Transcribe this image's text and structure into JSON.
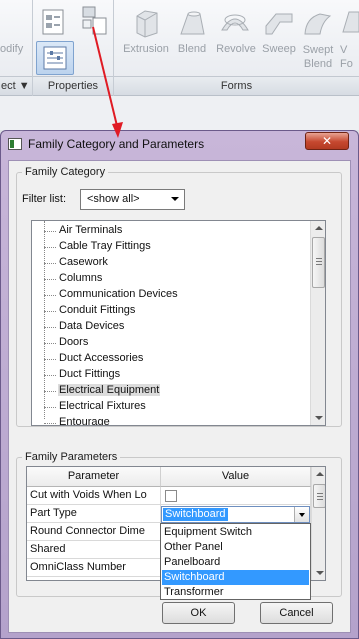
{
  "ribbon": {
    "left_label": "odify",
    "groups": [
      "ect ▼",
      "Properties",
      "Forms"
    ],
    "forms_tools": [
      {
        "label": "Extrusion",
        "icon": "extrusion-icon"
      },
      {
        "label": "Blend",
        "icon": "blend-icon"
      },
      {
        "label": "Revolve",
        "icon": "revolve-icon"
      },
      {
        "label": "Sweep",
        "icon": "sweep-icon"
      },
      {
        "label": "Swept\nBlend",
        "icon": "swept-blend-icon"
      },
      {
        "label": "V\nFo",
        "icon": "void-forms-icon"
      }
    ],
    "properties_icons": [
      "family-types-icon",
      "family-category-and-parameters-icon",
      "properties-icon"
    ]
  },
  "dialog": {
    "title": "Family Category and Parameters",
    "close_label": "✕",
    "family_category": {
      "group_title": "Family Category",
      "filter_label": "Filter list:",
      "filter_value": "<show all>",
      "items": [
        "Air Terminals",
        "Cable Tray Fittings",
        "Casework",
        "Columns",
        "Communication Devices",
        "Conduit Fittings",
        "Data Devices",
        "Doors",
        "Duct Accessories",
        "Duct Fittings",
        "Electrical Equipment",
        "Electrical Fixtures",
        "Entourage"
      ],
      "selected_item": "Electrical Equipment"
    },
    "family_parameters": {
      "group_title": "Family Parameters",
      "headers": {
        "parameter": "Parameter",
        "value": "Value"
      },
      "rows": [
        {
          "parameter": "Cut with Voids When Lo",
          "value": "",
          "type": "checkbox",
          "checked": false
        },
        {
          "parameter": "Part Type",
          "value": "Switchboard",
          "type": "combo"
        },
        {
          "parameter": "Round Connector Dime",
          "value": "",
          "type": "text"
        },
        {
          "parameter": "Shared",
          "value": "",
          "type": "text"
        },
        {
          "parameter": "OmniClass Number",
          "value": "",
          "type": "text"
        }
      ],
      "dropdown_options": [
        "Equipment Switch",
        "Other Panel",
        "Panelboard",
        "Switchboard",
        "Transformer"
      ],
      "dropdown_selected": "Switchboard"
    },
    "buttons": {
      "ok": "OK",
      "cancel": "Cancel"
    }
  },
  "colors": {
    "accent_arrow": "#e01b24",
    "selection": "#3399ff",
    "titlebar": "#c8b6d9"
  }
}
